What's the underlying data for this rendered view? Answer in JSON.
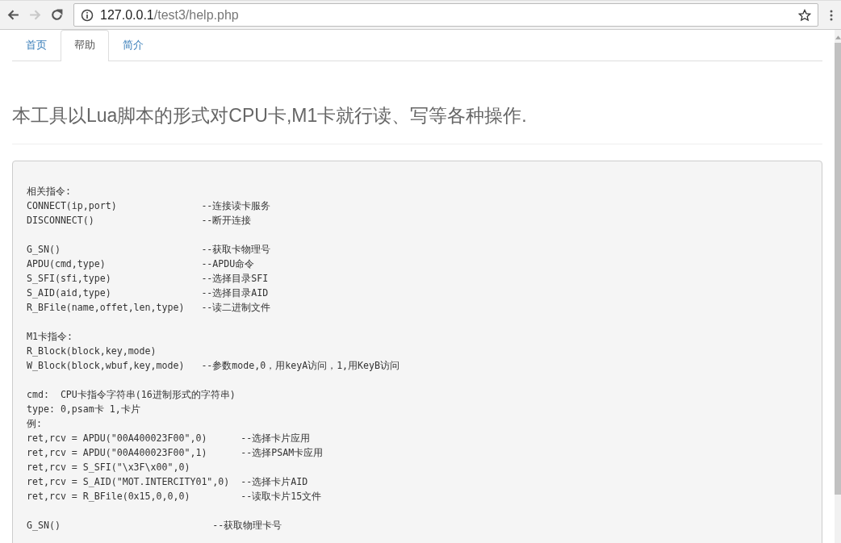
{
  "browser": {
    "back_disabled": false,
    "forward_disabled": true,
    "url": {
      "host": "127.0.0.1",
      "path": "/test3/help.php"
    }
  },
  "tabs": [
    {
      "label": "首页",
      "selected": false
    },
    {
      "label": "帮助",
      "selected": true
    },
    {
      "label": "简介",
      "selected": false
    }
  ],
  "heading": "本工具以Lua脚本的形式对CPU卡,M1卡就行读、写等各种操作.",
  "code_groups": [
    [
      "相关指令:",
      "CONNECT(ip,port)               --连接读卡服务",
      "DISCONNECT()                   --断开连接"
    ],
    [
      "G_SN()                         --获取卡物理号",
      "APDU(cmd,type)                 --APDU命令",
      "S_SFI(sfi,type)                --选择目录SFI",
      "S_AID(aid,type)                --选择目录AID",
      "R_BFile(name,offet,len,type)   --读二进制文件"
    ],
    [
      "M1卡指令:",
      "R_Block(block,key,mode)",
      "W_Block(block,wbuf,key,mode)   --参数mode,0，用keyA访问，1,用KeyB访问"
    ],
    [
      "cmd:  CPU卡指令字符串(16进制形式的字符串)",
      "type: 0,psam卡 1,卡片",
      "例:",
      "ret,rcv = APDU(\"00A400023F00\",0)      --选择卡片应用",
      "ret,rcv = APDU(\"00A400023F00\",1)      --选择PSAM卡应用",
      "ret,rcv = S_SFI(\"\\x3F\\x00\",0)",
      "ret,rcv = S_AID(\"MOT.INTERCITY01\",0)  --选择卡片AID",
      "ret,rcv = R_BFile(0x15,0,0,0)         --读取卡片15文件"
    ],
    [
      "G_SN()                           --获取物理卡号"
    ]
  ]
}
